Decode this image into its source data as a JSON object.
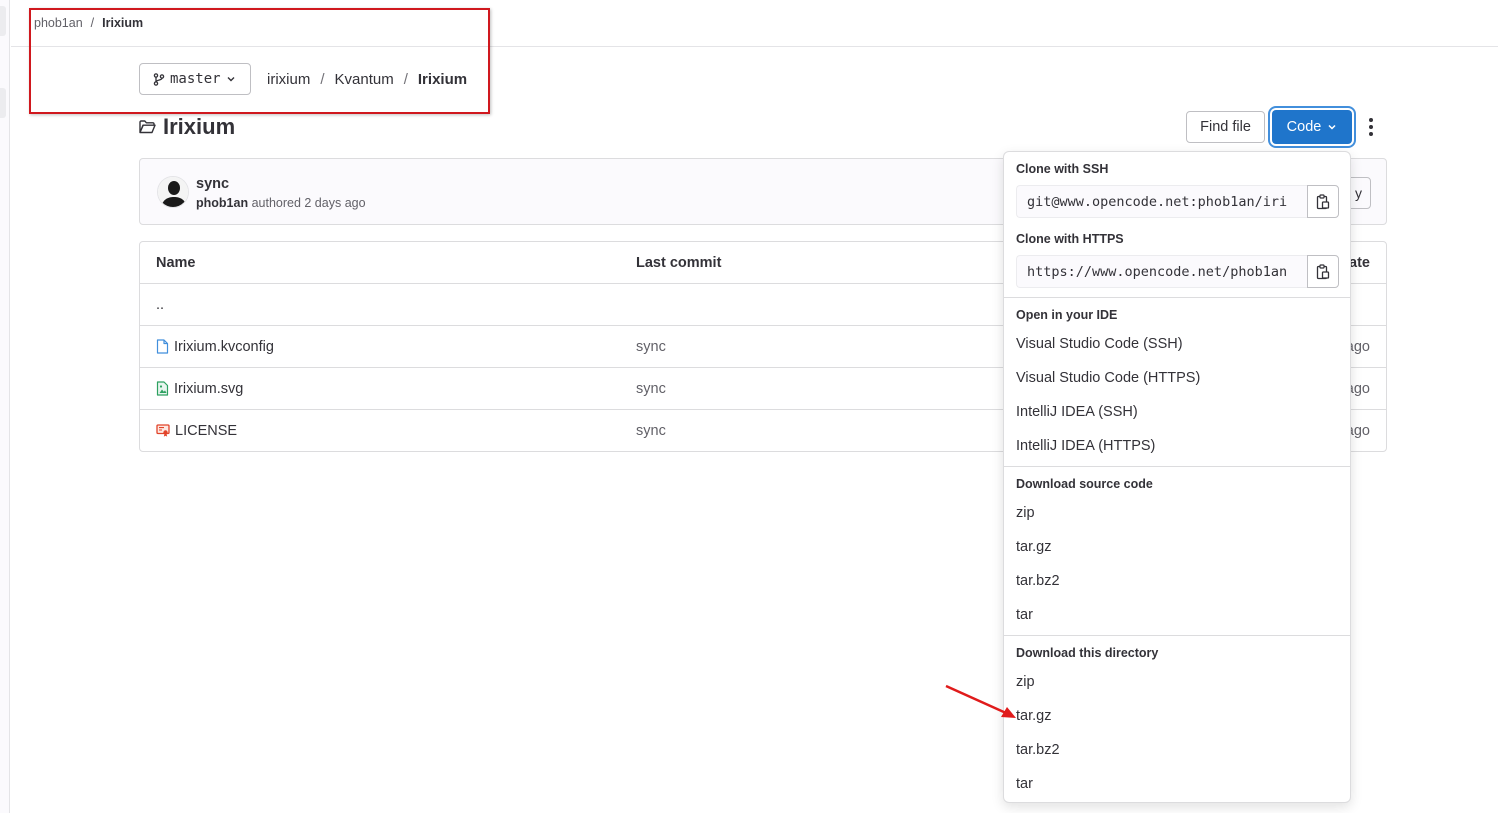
{
  "topbar": {
    "breadcrumb": [
      "phob1an",
      "Irixium"
    ]
  },
  "branch": {
    "label": "master"
  },
  "path": {
    "crumbs": [
      "irixium",
      "Kvantum",
      "Irixium"
    ]
  },
  "page": {
    "title": "Irixium"
  },
  "toolbar": {
    "find_file_label": "Find file",
    "code_label": "Code"
  },
  "commit": {
    "title": "sync",
    "author": "phob1an",
    "meta_text": " authored 2 days ago",
    "hidden_button_tail": "y"
  },
  "table": {
    "headers": {
      "name": "Name",
      "last_commit": "Last commit",
      "date": "ate"
    },
    "parent": "..",
    "rows": [
      {
        "name": "Irixium.kvconfig",
        "commit": "sync",
        "date": "ago",
        "icon": "file-icon"
      },
      {
        "name": "Irixium.svg",
        "commit": "sync",
        "date": "ago",
        "icon": "image-file-icon"
      },
      {
        "name": "LICENSE",
        "commit": "sync",
        "date": "ago",
        "icon": "license-icon"
      }
    ]
  },
  "dropdown": {
    "ssh_header": "Clone with SSH",
    "ssh_value": "git@www.opencode.net:phob1an/iri",
    "https_header": "Clone with HTTPS",
    "https_value": "https://www.opencode.net/phob1an",
    "ide_header": "Open in your IDE",
    "ide_items": [
      "Visual Studio Code (SSH)",
      "Visual Studio Code (HTTPS)",
      "IntelliJ IDEA (SSH)",
      "IntelliJ IDEA (HTTPS)"
    ],
    "source_header": "Download source code",
    "source_items": [
      "zip",
      "tar.gz",
      "tar.bz2",
      "tar"
    ],
    "dir_header": "Download this directory",
    "dir_items": [
      "zip",
      "tar.gz",
      "tar.bz2",
      "tar"
    ]
  },
  "colors": {
    "primary": "#1f75cb",
    "annotation": "#d0181e"
  }
}
